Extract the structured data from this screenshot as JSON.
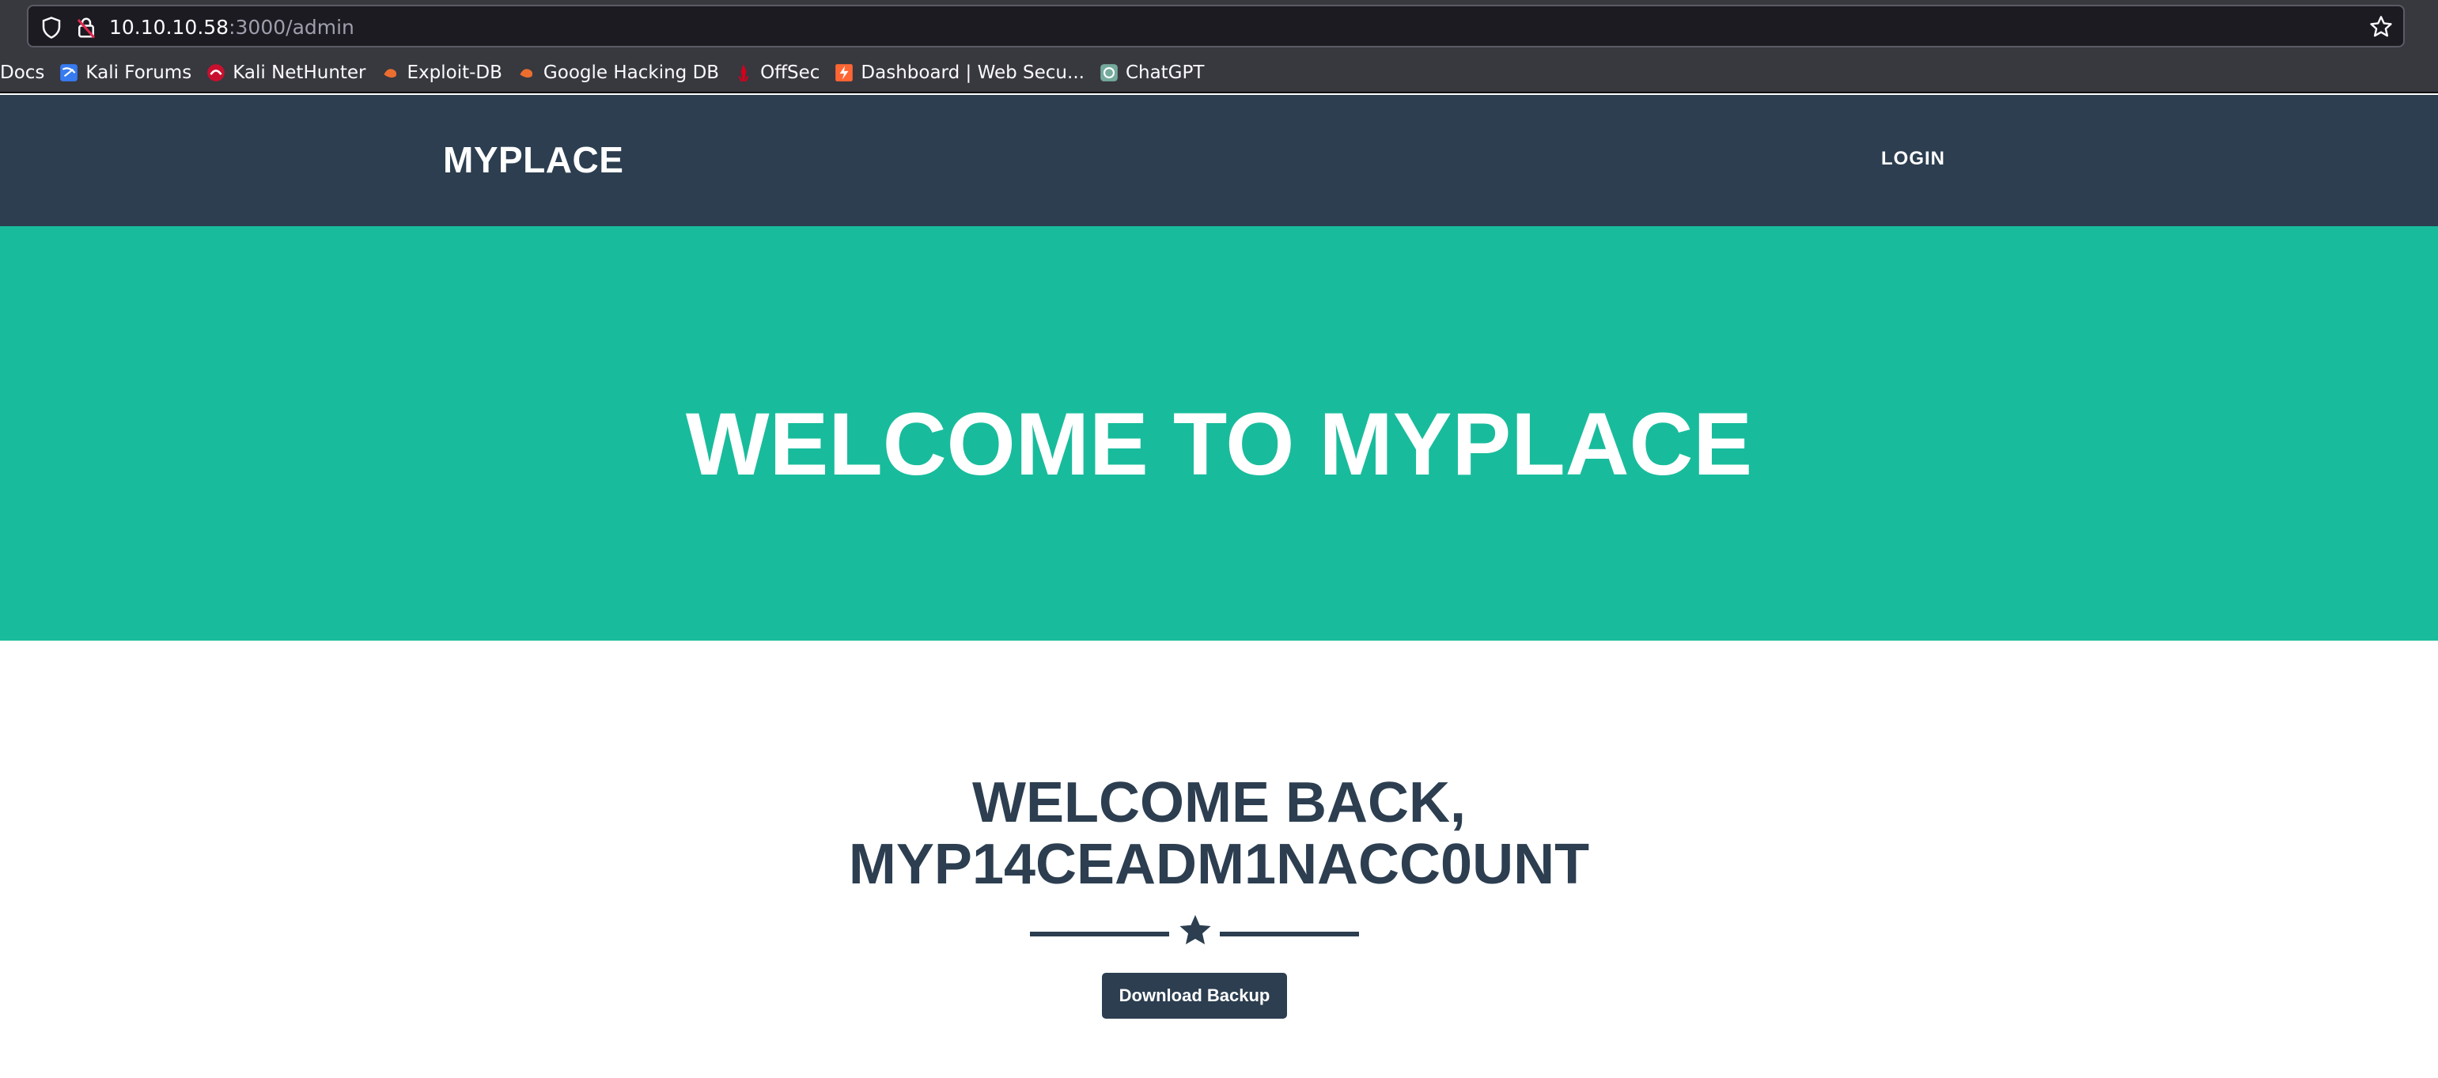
{
  "browser": {
    "url_host": "10.10.10.58",
    "url_path": ":3000/admin",
    "bookmarks": [
      {
        "label": "Docs",
        "icon": "none"
      },
      {
        "label": "Kali Forums",
        "icon": "kali-forums-icon"
      },
      {
        "label": "Kali NetHunter",
        "icon": "kali-nethunter-icon"
      },
      {
        "label": "Exploit-DB",
        "icon": "exploit-db-icon"
      },
      {
        "label": "Google Hacking DB",
        "icon": "ghdb-icon"
      },
      {
        "label": "OffSec",
        "icon": "offsec-icon"
      },
      {
        "label": "Dashboard | Web Secu...",
        "icon": "portswigger-icon"
      },
      {
        "label": "ChatGPT",
        "icon": "chatgpt-icon"
      }
    ]
  },
  "navbar": {
    "brand": "MYPLACE",
    "login_label": "LOGIN"
  },
  "hero": {
    "title": "WELCOME TO MYPLACE"
  },
  "welcome": {
    "line1": "WELCOME BACK,",
    "line2": "MYP14CEADM1NACC0UNT",
    "button_label": "Download Backup"
  },
  "colors": {
    "navbar": "#2c3e50",
    "hero": "#18bc9c",
    "text_dark": "#2c3e50"
  }
}
